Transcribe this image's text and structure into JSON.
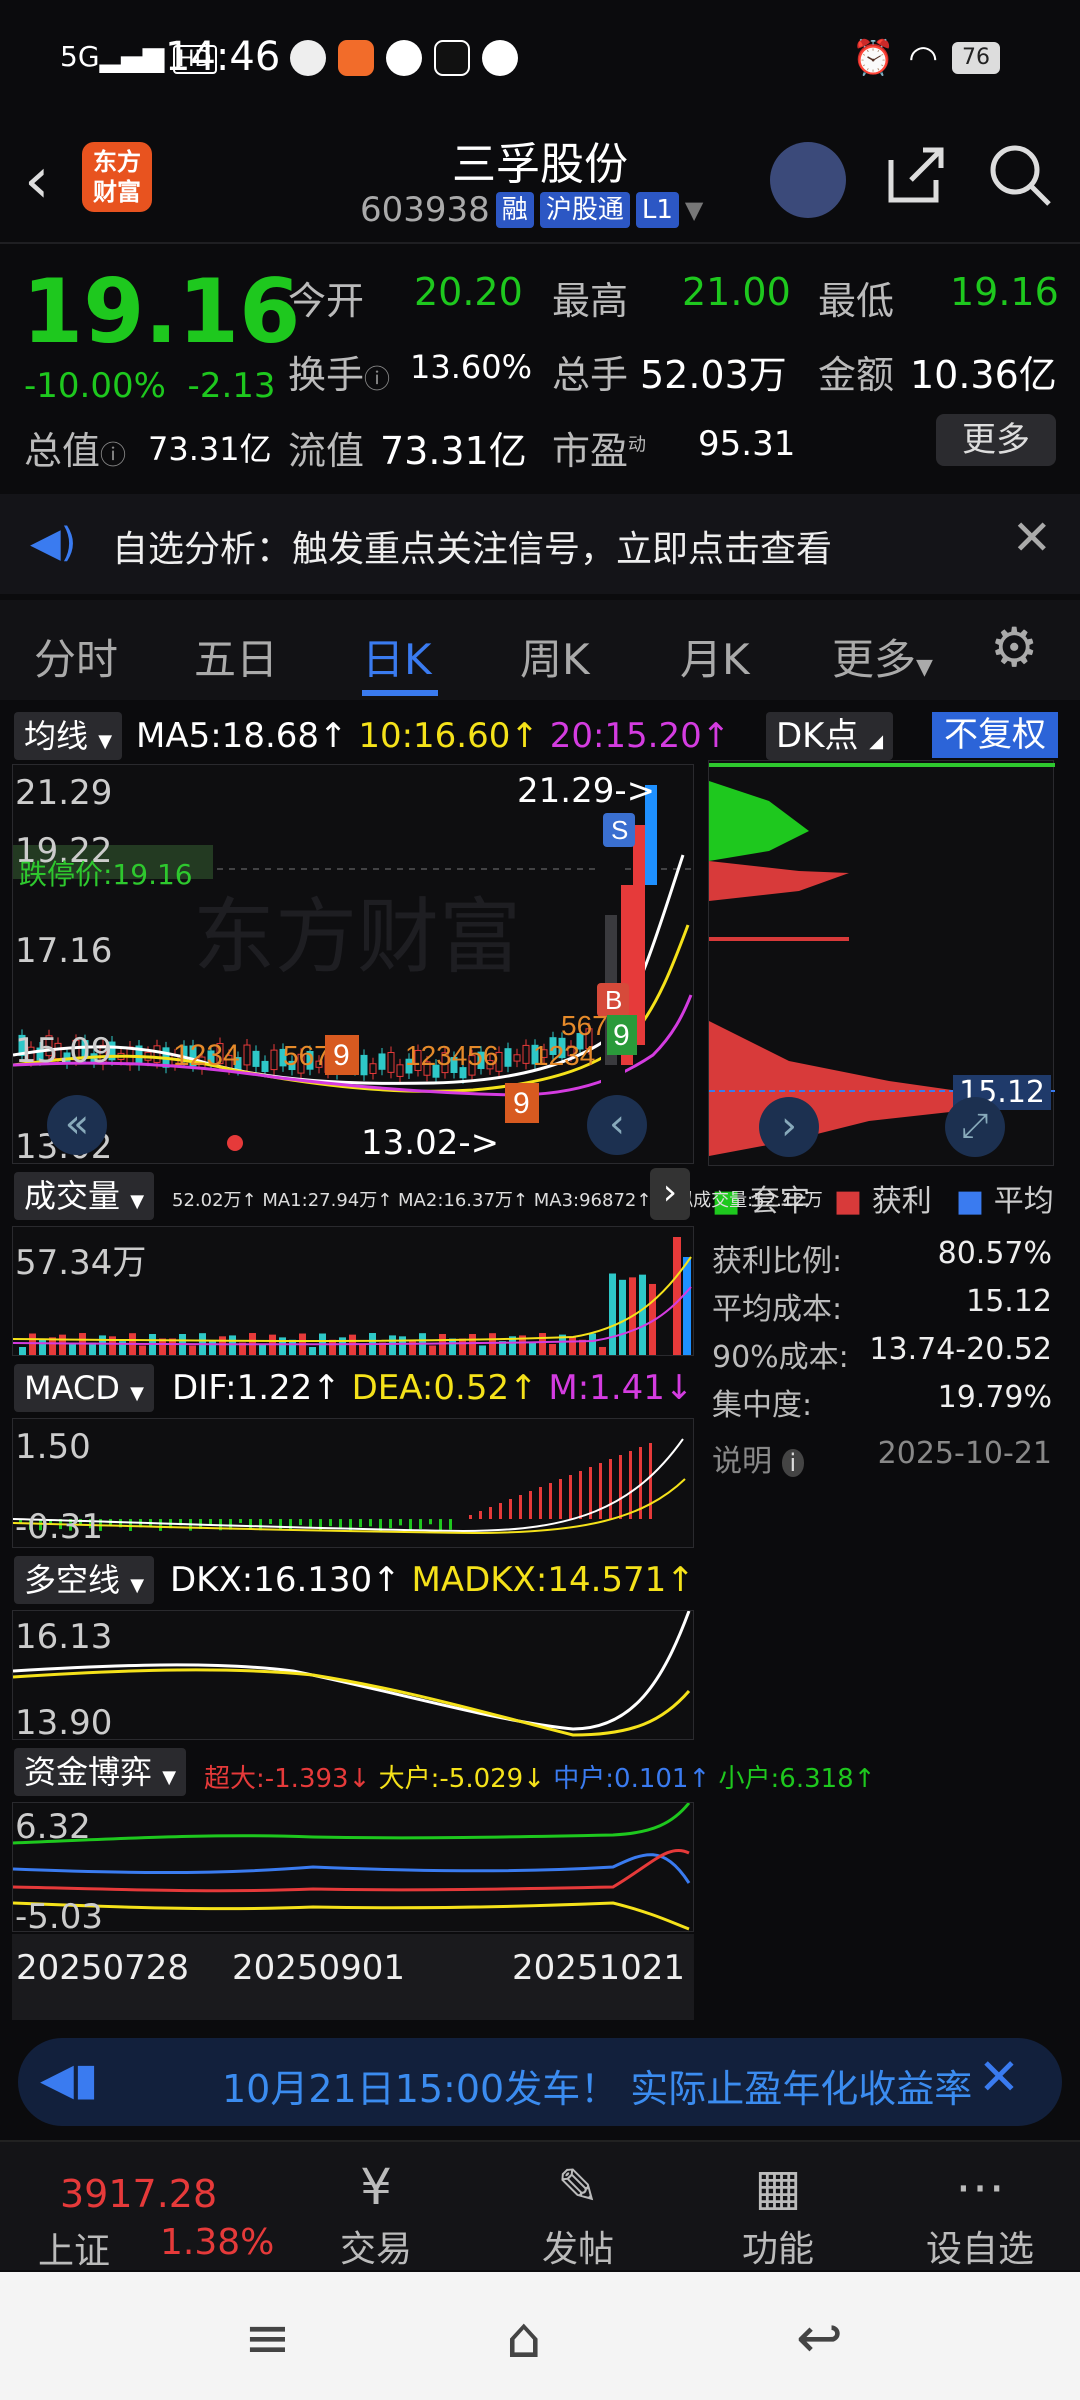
{
  "status_bar": {
    "signal": "5G",
    "time": "14:46",
    "battery": "76",
    "hd": "HD"
  },
  "header": {
    "title": "三孚股份",
    "code": "603938",
    "tags": [
      "融",
      "沪股通",
      "L1"
    ],
    "logo_text": "东方\n财富"
  },
  "quote": {
    "price": "19.16",
    "change_pct": "-10.00%",
    "change": "-2.13",
    "open_label": "今开",
    "open": "20.20",
    "high_label": "最高",
    "high": "21.00",
    "low_label": "最低",
    "low": "19.16",
    "turnover_label": "换手",
    "turnover": "13.60%",
    "volume_label": "总手",
    "volume": "52.03万",
    "amount_label": "金额",
    "amount": "10.36亿",
    "mktcap_label": "总值",
    "mktcap": "73.31亿",
    "float_label": "流值",
    "float": "73.31亿",
    "pe_label": "市盈",
    "pe_sup": "动",
    "pe": "95.31",
    "more": "更多"
  },
  "notice": {
    "text": "自选分析：触发重点关注信号，立即点击查看"
  },
  "tabs": [
    "分时",
    "五日",
    "日K",
    "周K",
    "月K",
    "更多"
  ],
  "active_tab": 2,
  "kline": {
    "selector": "均线",
    "ma5": "MA5:18.68↑",
    "ma10": "10:16.60↑",
    "ma20": "20:15.20↑",
    "dk": "DK点",
    "fq": "不复权",
    "y_top": "21.29",
    "y2": "19.22",
    "y3": "17.16",
    "y4": "15.09",
    "y_bot": "13.02",
    "limit_label": "跌停价:19.16",
    "max_mark": "21.29->",
    "min_mark": "13.02->",
    "watermark": "东方财富",
    "signal_s": "S",
    "signal_b": "B",
    "nine_a": "9",
    "nine_b": "9",
    "nine_c": "9",
    "seq_a": "567",
    "seq_b": "123456",
    "seq_c": "1234",
    "seq_d": "5678",
    "seq_e": "1234"
  },
  "volume": {
    "selector": "成交量",
    "line": "52.02万↑ MA1:27.94万↑ MA2:16.37万↑ MA3:96872↑ 虚拟成交量:52.12万",
    "y_top": "57.34万"
  },
  "macd": {
    "selector": "MACD",
    "dif": "DIF:1.22↑",
    "dea": "DEA:0.52↑",
    "m": "M:1.41↓",
    "y_top": "1.50",
    "y_bot": "-0.31"
  },
  "dkx": {
    "selector": "多空线",
    "dkx": "DKX:16.130↑",
    "madkx": "MADKX:14.571↑",
    "y_top": "16.13",
    "y_bot": "13.90"
  },
  "fund": {
    "selector": "资金博弈",
    "super": "超大:-1.393↓",
    "big": "大户:-5.029↓",
    "mid": "中户:0.101↑",
    "small": "小户:6.318↑",
    "y_top": "6.32",
    "y_bot": "-5.03"
  },
  "dates": [
    "20250728",
    "20250901",
    "20251021"
  ],
  "chip": {
    "avg_tag": "15.12",
    "legend": [
      "套牢",
      "获利",
      "平均"
    ],
    "rows": [
      {
        "k": "获利比例:",
        "v": "80.57%"
      },
      {
        "k": "平均成本:",
        "v": "15.12"
      },
      {
        "k": "90%成本:",
        "v": "13.74-20.52"
      },
      {
        "k": "集中度:",
        "v": "19.79%"
      }
    ],
    "note": "说明",
    "date": "2025-10-21"
  },
  "promo": {
    "text": "10月21日15:00发车！ 实际止盈年化收益率"
  },
  "bottom": {
    "index_value": "3917.28",
    "index_name": "上证",
    "index_pct": "1.38%",
    "items": [
      "交易",
      "发帖",
      "功能",
      "设自选"
    ]
  },
  "colors": {
    "up": "#e63a3a",
    "down": "#1ec81e",
    "accent": "#3a7bf0",
    "ma5": "#ffffff",
    "ma10": "#f5e21a",
    "ma20": "#d43ce0"
  }
}
